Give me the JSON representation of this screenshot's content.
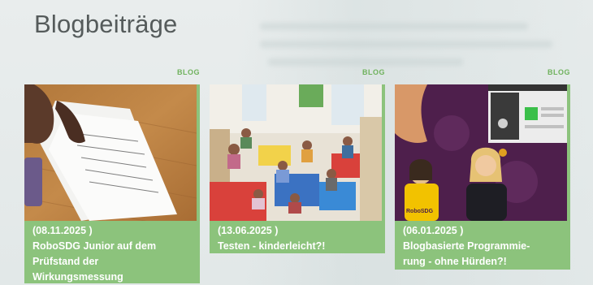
{
  "page": {
    "title": "Blogbeiträge"
  },
  "posts": [
    {
      "category": "BLOG",
      "date": "(08.11.2025 )",
      "title_lines": [
        "RoboSDG Junior auf dem",
        "Prüfstand der",
        "Wirkungsmessung"
      ],
      "image": "photo-children-hands-on-papers"
    },
    {
      "category": "BLOG",
      "date": "(13.06.2025 )",
      "title_lines": [
        "Testen - kinderleicht?!"
      ],
      "image": "photo-children-in-classroom"
    },
    {
      "category": "BLOG",
      "date": "(06.01.2025 )",
      "title_lines": [
        "Blogbasierte Programmie-",
        "rung - ohne Hürden?!"
      ],
      "image": "photo-two-women-purple-background",
      "image_text": "RoboSDG"
    }
  ],
  "colors": {
    "accent_green": "#8cc37c",
    "badge_green": "#6fb25d",
    "title_gray": "#555b5b"
  }
}
